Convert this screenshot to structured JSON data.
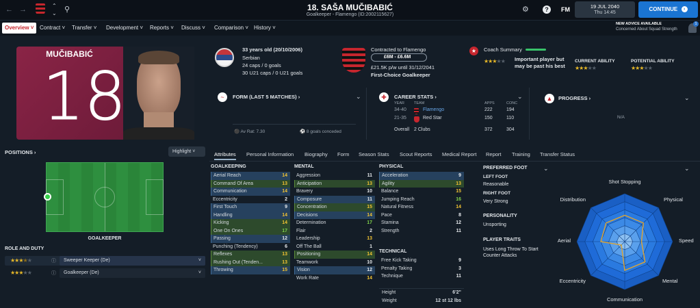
{
  "topbar": {
    "title": "18. SAŠA MUČIBABIĆ",
    "subtitle": "Goalkeeper - Flamengo (ID:2002115627)",
    "date": "19 JUL 2040",
    "time": "Thu 14:45",
    "continue_label": "CONTINUE",
    "fm_label": "FM",
    "advice_title": "NEW ADVICE AVAILABLE",
    "advice_text": "Concerned About Squad Strength",
    "notif_count": "1"
  },
  "nav": {
    "items": [
      "Overview",
      "Contract",
      "Transfer",
      "Development",
      "Reports",
      "Discuss",
      "Comparison",
      "History"
    ]
  },
  "profile": {
    "shirt_name": "MUČIBABIĆ",
    "shirt_number": "18",
    "age": "33 years old (20/10/2006)",
    "nationality": "Serbian",
    "caps": "24 caps / 0 goals",
    "u21caps": "30 U21 caps / 0 U21 goals",
    "contract_status": "Contracted to Flamengo",
    "value": "£6M - £6.6M",
    "wage": "£21.5K p/w until 31/12/2041",
    "squad_status": "First-Choice Goalkeeper",
    "coach_summary_title": "Coach Summary",
    "coach_summary_text": "Important player but may be past his best",
    "current_ability_label": "CURRENT ABILITY",
    "potential_ability_label": "POTENTIAL ABILITY"
  },
  "form": {
    "title": "FORM (LAST 5 MATCHES)",
    "av_rat": "Av Rat: 7.30",
    "conceded": "8 goals conceded"
  },
  "career": {
    "title": "CAREER STATS",
    "headers": [
      "YEAR",
      "TEAM",
      "APPS",
      "CONC"
    ],
    "rows": [
      {
        "year": "34-40",
        "team": "Flamengo",
        "apps": "222",
        "conc": "194"
      },
      {
        "year": "21-35",
        "team": "Red Star",
        "apps": "150",
        "conc": "110"
      }
    ],
    "overall_label": "Overall",
    "overall_clubs": "2 Clubs",
    "overall_apps": "372",
    "overall_conc": "304"
  },
  "progress": {
    "title": "PROGRESS",
    "value": "N/A"
  },
  "positions": {
    "title": "POSITIONS",
    "highlight_label": "Highlight",
    "position_name": "GOALKEEPER",
    "role_title": "ROLE AND DUTY",
    "roles": [
      {
        "name": "Sweeper Keeper (De)"
      },
      {
        "name": "Goalkeeper (De)"
      }
    ]
  },
  "tabs": [
    "Attributes",
    "Personal Information",
    "Biography",
    "Form",
    "Season Stats",
    "Scout Reports",
    "Medical Report",
    "Report",
    "Training",
    "Transfer Status"
  ],
  "attributes": {
    "goalkeeping_title": "GOALKEEPING",
    "goalkeeping": [
      {
        "name": "Aerial Reach",
        "value": "14",
        "hl": "blue"
      },
      {
        "name": "Command Of Area",
        "value": "13",
        "hl": "green"
      },
      {
        "name": "Communication",
        "value": "14",
        "hl": "blue"
      },
      {
        "name": "Eccentricity",
        "value": "2",
        "hl": ""
      },
      {
        "name": "First Touch",
        "value": "9",
        "hl": "blue"
      },
      {
        "name": "Handling",
        "value": "14",
        "hl": "blue"
      },
      {
        "name": "Kicking",
        "value": "14",
        "hl": "green"
      },
      {
        "name": "One On Ones",
        "value": "17",
        "hl": "green"
      },
      {
        "name": "Passing",
        "value": "12",
        "hl": "blue"
      },
      {
        "name": "Punching (Tendency)",
        "value": "6",
        "hl": ""
      },
      {
        "name": "Reflexes",
        "value": "13",
        "hl": "green"
      },
      {
        "name": "Rushing Out (Tenden...",
        "value": "13",
        "hl": "green"
      },
      {
        "name": "Throwing",
        "value": "15",
        "hl": "blue"
      }
    ],
    "mental_title": "MENTAL",
    "mental": [
      {
        "name": "Aggression",
        "value": "11",
        "hl": ""
      },
      {
        "name": "Anticipation",
        "value": "13",
        "hl": "green"
      },
      {
        "name": "Bravery",
        "value": "10",
        "hl": ""
      },
      {
        "name": "Composure",
        "value": "11",
        "hl": "blue"
      },
      {
        "name": "Concentration",
        "value": "15",
        "hl": "green"
      },
      {
        "name": "Decisions",
        "value": "14",
        "hl": "blue"
      },
      {
        "name": "Determination",
        "value": "17",
        "hl": ""
      },
      {
        "name": "Flair",
        "value": "2",
        "hl": ""
      },
      {
        "name": "Leadership",
        "value": "13",
        "hl": ""
      },
      {
        "name": "Off The Ball",
        "value": "1",
        "hl": ""
      },
      {
        "name": "Positioning",
        "value": "14",
        "hl": "green"
      },
      {
        "name": "Teamwork",
        "value": "10",
        "hl": ""
      },
      {
        "name": "Vision",
        "value": "12",
        "hl": "blue"
      },
      {
        "name": "Work Rate",
        "value": "14",
        "hl": ""
      }
    ],
    "physical_title": "PHYSICAL",
    "physical": [
      {
        "name": "Acceleration",
        "value": "9",
        "hl": "blue"
      },
      {
        "name": "Agility",
        "value": "13",
        "hl": "green"
      },
      {
        "name": "Balance",
        "value": "15",
        "hl": ""
      },
      {
        "name": "Jumping Reach",
        "value": "16",
        "hl": ""
      },
      {
        "name": "Natural Fitness",
        "value": "14",
        "hl": ""
      },
      {
        "name": "Pace",
        "value": "8",
        "hl": ""
      },
      {
        "name": "Stamina",
        "value": "12",
        "hl": ""
      },
      {
        "name": "Strength",
        "value": "11",
        "hl": ""
      }
    ],
    "technical_title": "TECHNICAL",
    "technical": [
      {
        "name": "Free Kick Taking",
        "value": "9",
        "hl": ""
      },
      {
        "name": "Penalty Taking",
        "value": "3",
        "hl": ""
      },
      {
        "name": "Technique",
        "value": "11",
        "hl": ""
      }
    ],
    "height_label": "Height",
    "height": "6'2\"",
    "weight_label": "Weight",
    "weight": "12 st 12 lbs"
  },
  "info": {
    "preferred_foot_title": "PREFERRED FOOT",
    "left_foot_label": "LEFT FOOT",
    "left_foot": "Reasonable",
    "right_foot_label": "RIGHT FOOT",
    "right_foot": "Very Strong",
    "personality_title": "PERSONALITY",
    "personality": "Unsporting",
    "traits_title": "PLAYER TRAITS",
    "traits": "Uses Long Throw To Start Counter Attacks"
  },
  "radar": {
    "labels": [
      "Shot Stopping",
      "Physical",
      "Speed",
      "Mental",
      "Communication",
      "Eccentricity",
      "Aerial",
      "Distribution"
    ]
  },
  "colors": {
    "accent_blue": "#1a74d2",
    "green_val": "#7fd14a",
    "yellow_val": "#f1c232",
    "radar_fill": "#1e6ee0",
    "radar_line": "#e0a531"
  }
}
